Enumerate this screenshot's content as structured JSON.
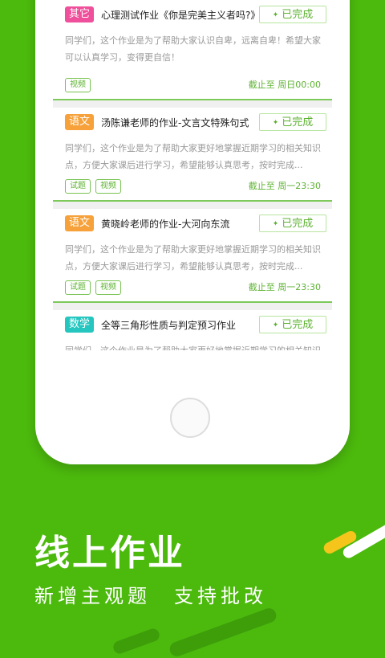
{
  "cards": [
    {
      "tag": "其它",
      "title": "心理测试作业《你是完美主义者吗?》",
      "status": "已完成",
      "description": "同学们，这个作业是为了帮助大家认识自卑，远离自卑！希望大家可以认真学习，变得更自信！",
      "chips": [
        "视频"
      ],
      "deadline": "截止至 周日00:00"
    },
    {
      "tag": "语文",
      "title": "汤陈谦老师的作业-文言文特殊句式",
      "status": "已完成",
      "description": "同学们，这个作业是为了帮助大家更好地掌握近期学习的相关知识点，方便大家课后进行学习，希望能够认真思考，按时完成...",
      "chips": [
        "试题",
        "视频"
      ],
      "deadline": "截止至 周一23:30"
    },
    {
      "tag": "语文",
      "title": "黄晓岭老师的作业-大河向东流",
      "status": "已完成",
      "description": "同学们，这个作业是为了帮助大家更好地掌握近期学习的相关知识点，方便大家课后进行学习，希望能够认真思考，按时完成...",
      "chips": [
        "试题",
        "视频"
      ],
      "deadline": "截止至 周一23:30"
    },
    {
      "tag": "数学",
      "title": "全等三角形性质与判定预习作业",
      "status": "已完成",
      "description": "同学们，这个作业是为了帮助大家更好地掌握近期学习的相关知识点，方便大家课后进行学习，希望能够认真思考，按时完成..."
    }
  ],
  "promo": {
    "headline": "线上作业",
    "subline": "新增主观题　支持批改"
  },
  "colors": {
    "background": "#4cba0d",
    "accent": "#5db231",
    "tag_other": "#ef4f9b",
    "tag_chinese": "#f6a13a",
    "tag_math": "#26c6c0"
  }
}
